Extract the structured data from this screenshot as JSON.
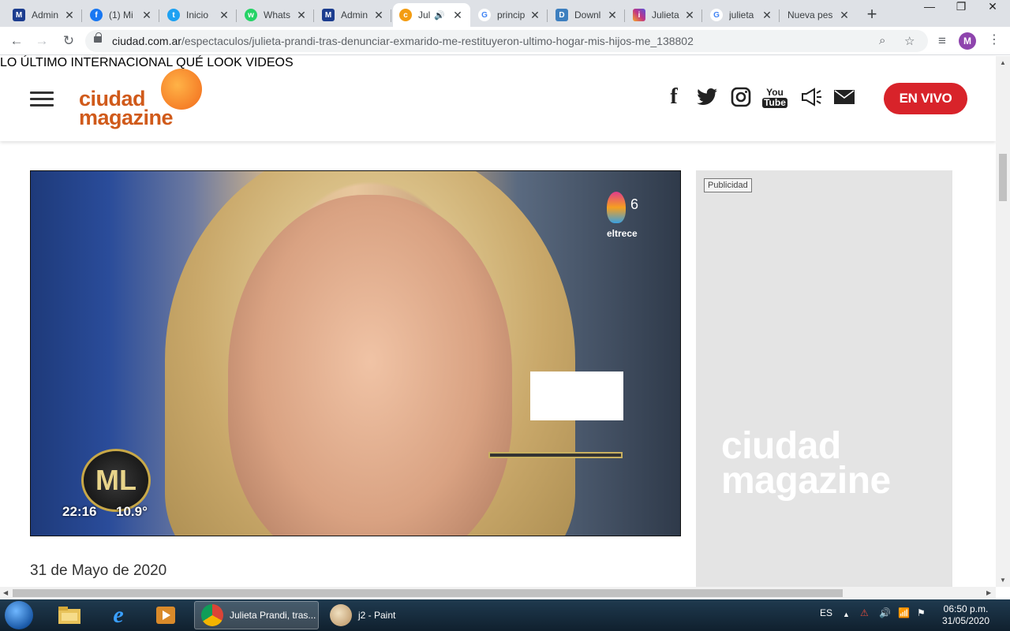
{
  "browser": {
    "tabs": [
      {
        "title": "Admin",
        "favicon": "M",
        "favicon_color": "#1c3d8f"
      },
      {
        "title": "(1) Mi",
        "favicon": "f",
        "favicon_color": "#1877f2"
      },
      {
        "title": "Inicio",
        "favicon": "t",
        "favicon_color": "#1da1f2"
      },
      {
        "title": "Whats",
        "favicon": "w",
        "favicon_color": "#25d366"
      },
      {
        "title": "Admin",
        "favicon": "M",
        "favicon_color": "#1c3d8f"
      },
      {
        "title": "Jul",
        "favicon": "c",
        "favicon_color": "#f39c12",
        "active": true
      },
      {
        "title": "princip",
        "favicon": "G",
        "favicon_color": "#4285f4"
      },
      {
        "title": "Downl",
        "favicon": "D",
        "favicon_color": "#3d7fbf"
      },
      {
        "title": "Julieta",
        "favicon": "i",
        "favicon_color": "#c13584"
      },
      {
        "title": "julieta",
        "favicon": "G",
        "favicon_color": "#4285f4"
      },
      {
        "title": "Nueva pes",
        "favicon": "",
        "favicon_color": "#dee1e6"
      }
    ],
    "url_host": "ciudad.com.ar",
    "url_path": "/espectaculos/julieta-prandi-tras-denunciar-exmarido-me-restituyeron-ultimo-hogar-mis-hijos-me_138802",
    "profile_initial": "M"
  },
  "site": {
    "logo_line1": "ciudad",
    "logo_line2": "magazine",
    "nav": [
      "LO ÚLTIMO",
      "INTERNACIONAL",
      "QUÉ LOOK",
      "VIDEOS"
    ],
    "live_button": "EN VIVO",
    "social_icons": [
      "facebook-icon",
      "twitter-icon",
      "instagram-icon",
      "youtube-icon",
      "megaphone-icon",
      "mail-icon"
    ],
    "youtube_label_top": "You",
    "youtube_label_bottom": "Tube"
  },
  "article": {
    "video_overlay_time": "22:16",
    "video_overlay_temp": "10.9°",
    "channel_name": "eltrece",
    "show_logo": "ML",
    "date": "31 de Mayo de 2020"
  },
  "ad": {
    "label": "Publicidad",
    "logo_line1": "ciudad",
    "logo_line2": "magazine"
  },
  "taskbar": {
    "tasks": [
      {
        "title": "Julieta Prandi, tras...",
        "active": true
      },
      {
        "title": "j2 - Paint",
        "active": false
      }
    ],
    "language": "ES",
    "time": "06:50 p.m.",
    "date": "31/05/2020"
  },
  "colors": {
    "brand_orange": "#d05a1a",
    "live_red": "#d8232a",
    "ad_bg": "#e4e4e4"
  }
}
